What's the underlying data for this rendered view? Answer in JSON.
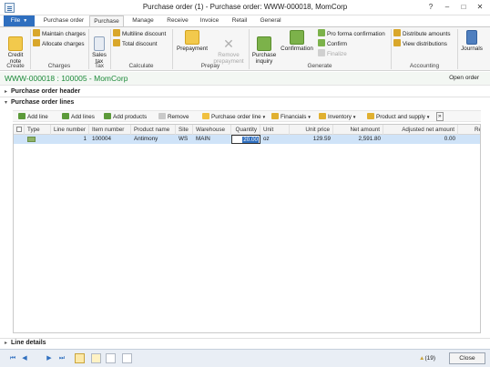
{
  "window": {
    "title": "Purchase order (1) - Purchase order: WWW-000018, MomCorp",
    "buttons": [
      "?",
      "–",
      "□",
      "✕"
    ]
  },
  "ribbon": {
    "tabs": [
      "File",
      "Purchase order",
      "Purchase",
      "Manage",
      "Receive",
      "Invoice",
      "Retail",
      "General"
    ],
    "active_tab": "Purchase",
    "groups": {
      "create": {
        "label": "Create",
        "credit_note": "Credit\nnote"
      },
      "charges": {
        "label": "Charges",
        "maintain": "Maintain charges",
        "allocate": "Allocate charges"
      },
      "tax": {
        "label": "Tax",
        "sales_tax": "Sales\ntax"
      },
      "calculate": {
        "label": "Calculate",
        "multiline": "Multiline discount",
        "total": "Total discount"
      },
      "prepay": {
        "label": "Prepay",
        "prepayment": "Prepayment",
        "remove": "Remove\nprepayment"
      },
      "generate": {
        "label": "Generate",
        "inquiry": "Purchase\ninquiry",
        "confirmation": "Confirmation",
        "pro_forma": "Pro forma confirmation",
        "confirm": "Confirm",
        "finalize": "Finalize"
      },
      "accounting": {
        "label": "Accounting",
        "distribute": "Distribute amounts",
        "view_dist": "View distributions"
      },
      "journals": {
        "label": "Journals"
      }
    }
  },
  "header": {
    "order_id": "WWW-000018 : 100005 - MomCorp",
    "status": "Open order"
  },
  "fasttabs": {
    "po_header": "Purchase order header",
    "po_lines": "Purchase order lines",
    "line_details": "Line details"
  },
  "lines_toolbar": {
    "add_line": "Add line",
    "add_lines": "Add lines",
    "add_products": "Add products",
    "remove": "Remove",
    "po_line": "Purchase order line",
    "financials": "Financials",
    "inventory": "Inventory",
    "product_supply": "Product and supply",
    "more": "»"
  },
  "grid": {
    "columns": [
      "Type",
      "Line number",
      "Item number",
      "Product name",
      "Site",
      "Warehouse",
      "Quantity",
      "Unit",
      "Unit price",
      "Net amount",
      "Adjusted net amount",
      "Re"
    ],
    "rows": [
      {
        "line_number": "1",
        "item_number": "100004",
        "product_name": "Antimony",
        "site": "WS",
        "warehouse": "MAIN",
        "quantity": "20.00",
        "unit": "oz",
        "unit_price": "129.59",
        "net_amount": "2,591.80",
        "adjusted_net_amount": "0.00"
      }
    ]
  },
  "statusbar": {
    "notifications": "(19)",
    "close": "Close"
  },
  "colors": {
    "accent": "#2f6fbf",
    "header_green": "#1d8a3a",
    "row_selected": "#cfe3f8"
  }
}
